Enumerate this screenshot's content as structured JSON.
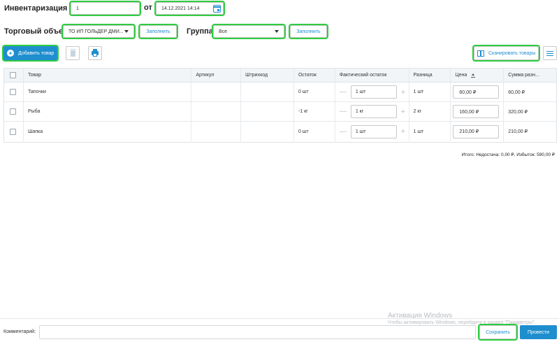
{
  "header": {
    "title": "Инвентаризация №",
    "doc_number": "1",
    "from_label": "от",
    "doc_date": "14.12.2021 14:14",
    "calendar_icon": "calendar-icon"
  },
  "filters": {
    "shop_label": "Торговый объект",
    "shop_value": "ТО ИП ГОЛЬДЕР ДМИ...",
    "fill_label": "Заполнить",
    "group_label": "Группа",
    "group_value": "Все"
  },
  "toolbar": {
    "add_label": "Добавить товар",
    "scan_label": "Сканировать товары"
  },
  "table": {
    "headers": {
      "name": "Товар",
      "article": "Артикул",
      "barcode": "Штрихкод",
      "stock": "Остаток",
      "actual": "Фактический остаток",
      "diff": "Разница",
      "price": "Цена",
      "sum": "Сумма разн..."
    },
    "rows": [
      {
        "name": "Тапочки",
        "article": "",
        "barcode": "",
        "stock": "0 шт",
        "actual": "1 шт",
        "diff": "1 шт",
        "price": "60,00 ₽",
        "sum": "60,00 ₽"
      },
      {
        "name": "Рыба",
        "article": "",
        "barcode": "",
        "stock": "-1 кг",
        "actual": "1 кг",
        "diff": "2 кг",
        "price": "160,00 ₽",
        "sum": "320,00 ₽"
      },
      {
        "name": "Шапка",
        "article": "",
        "barcode": "",
        "stock": "0 шт",
        "actual": "1 шт",
        "diff": "1 шт",
        "price": "210,00 ₽",
        "sum": "210,00 ₽"
      }
    ]
  },
  "totals": "Итого: Недостача: 0,00 ₽, Избыток: 590,00 ₽",
  "footer": {
    "comment_label": "Комментарий:",
    "comment_value": "",
    "save_label": "Сохранить",
    "post_label": "Провести"
  },
  "watermark": {
    "line1": "Активация Windows",
    "line2": "Чтобы активировать Windows, перейдите в раздел \"Параметры\"."
  },
  "colors": {
    "accent": "#1e8ecf",
    "highlight": "#2ecc40"
  }
}
